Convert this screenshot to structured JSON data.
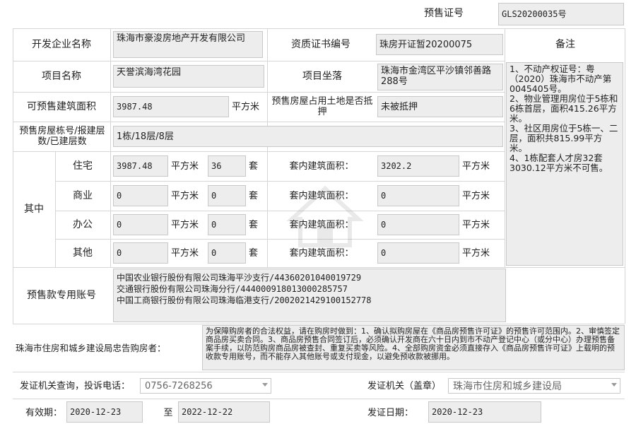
{
  "header": {
    "cert_label": "预售证号",
    "cert_value": "GLS20200035号"
  },
  "developer": {
    "label": "开发企业名称",
    "value": "珠海市豪浚房地产开发有限公司"
  },
  "qualification": {
    "label": "资质证书编号",
    "value": "珠房开证暂20200075"
  },
  "remarks": {
    "label": "备注",
    "value": "1、不动产权证号：粤（2020）珠海市不动产第0045405号。\n2、物业管理用房位于5栋和6栋首层，面积415.26平方米。\n3、社区用房位于5栋一、二层，面积共815.99平方米。\n4、1栋配套人才房32套3030.12平方米不可售。"
  },
  "project": {
    "label": "项目名称",
    "value": "天誉滨海湾花园"
  },
  "location": {
    "label": "项目坐落",
    "value": "珠海市金湾区平沙镇邻善路288号"
  },
  "presale_area": {
    "label": "可预售建筑面积",
    "value": "3987.48",
    "unit": "平方米"
  },
  "mortgage": {
    "label": "预售房屋占用土地是否抵押",
    "value": "未被抵押"
  },
  "building": {
    "label": "预售房屋栋号/报建层数/已建层数",
    "value": "1栋/18层/8层"
  },
  "breakdown": {
    "group_label": "其中",
    "area_unit": "平方米",
    "set_unit": "套",
    "inner_label": "套内建筑面积：",
    "rows": [
      {
        "label": "住宅",
        "area": "3987.48",
        "sets": "36",
        "inner": "3202.2"
      },
      {
        "label": "商业",
        "area": "0",
        "sets": "0",
        "inner": "0"
      },
      {
        "label": "办公",
        "area": "0",
        "sets": "0",
        "inner": "0"
      },
      {
        "label": "其他",
        "area": "0",
        "sets": "0",
        "inner": "0"
      }
    ]
  },
  "accounts": {
    "label": "预售款专用账号",
    "lines": [
      "中国农业银行股份有限公司珠海平沙支行/44360201040019729",
      "交通银行股份有限公司珠海分行/444000918013000285757",
      "中国工商银行股份有限公司珠海临港支行/2002021429100152778"
    ]
  },
  "notice": {
    "label": "珠海市住房和城乡建设局忠告购房者：",
    "text": "为保障购房者的合法权益，请在购房时做到：1、确认拟购房屋在《商品房预售许可证》的预售许可范围内。2、审慎签定商品房买卖合同。3、商品房预售合同签订后，必须确认开发商在六十日内到市不动产登记中心（或分中心）办理预售备案手续，以防范购房商品房被查封、重复买卖等风险。4、全部购房资金必须直接存入《商品房预售许可证》上载明的预收款专用账号，而不能存入其他账号或支付现金，以避免预收款被挪用。"
  },
  "inquiry": {
    "label": "发证机关查询，投诉电话：",
    "value": "0756-7268256"
  },
  "issuer": {
    "label": "发证机关（盖章）",
    "value": "珠海市住房和城乡建设局"
  },
  "validity": {
    "label": "有效期：",
    "from": "2020-12-23",
    "to_label": "至",
    "to": "2022-12-22"
  },
  "issue_date": {
    "label": "发证日期：",
    "value": "2020-12-23"
  }
}
